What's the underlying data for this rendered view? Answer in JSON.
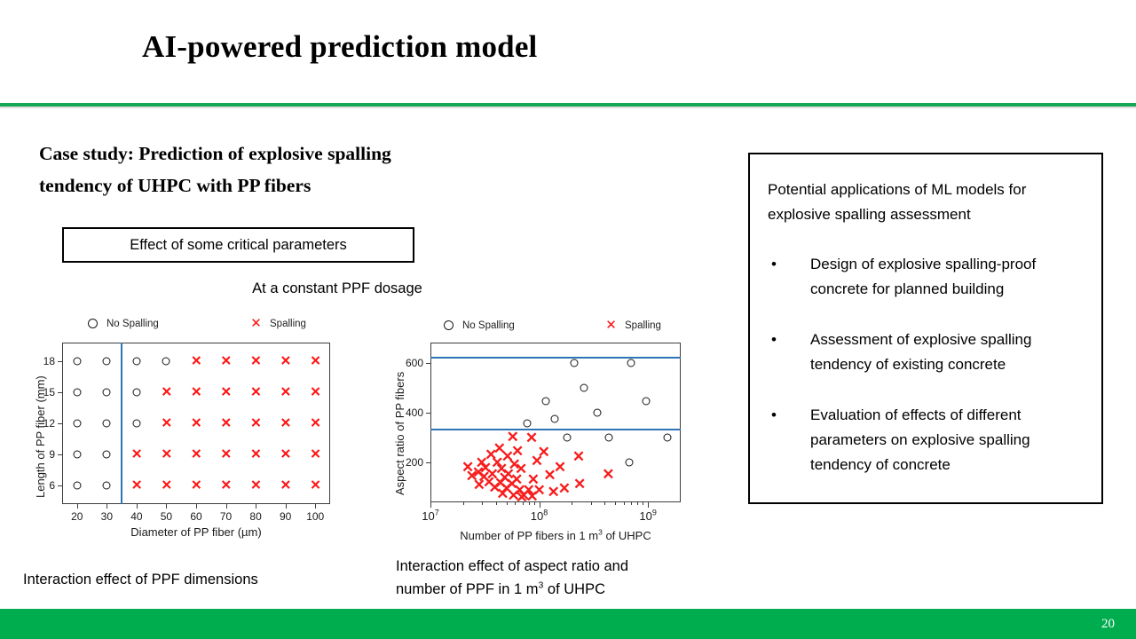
{
  "slide": {
    "title": "AI-powered prediction model",
    "page_number": "20",
    "accent_green": "#00ad4e",
    "rule_green": "#14a856"
  },
  "left": {
    "case_study_line1": "Case study: Prediction of explosive spalling",
    "case_study_line2": "tendency of UHPC with PP fibers",
    "param_box_label": "Effect of some critical parameters",
    "dosage_label": "At a constant PPF dosage",
    "caption_left": "Interaction effect of PPF dimensions",
    "caption_right_line1": "Interaction effect of aspect ratio and",
    "caption_right_line2_a": "number of PPF in 1 m",
    "caption_right_line2_sup": "3",
    "caption_right_line2_b": " of UHPC"
  },
  "applications": {
    "intro": "Potential applications of ML models for explosive spalling assessment",
    "bullet_char": "•",
    "items": [
      " Design of explosive spalling-proof concrete for planned building",
      "Assessment of explosive spalling tendency of existing concrete",
      "Evaluation of effects of different parameters on explosive spalling tendency of concrete"
    ]
  },
  "chart_data": [
    {
      "id": "ppf-dimensions",
      "type": "scatter",
      "title": "Interaction effect of PPF dimensions",
      "xlabel": "Diameter of PP fiber (µm)",
      "ylabel": "Length of PP fiber (mm)",
      "xticks": [
        20,
        30,
        40,
        50,
        60,
        70,
        80,
        90,
        100
      ],
      "yticks": [
        6,
        9,
        12,
        15,
        18
      ],
      "xlim": [
        15,
        105
      ],
      "ylim": [
        4.2,
        19.8
      ],
      "grid": false,
      "legend": [
        {
          "label": "No Spalling",
          "marker": "circle",
          "color": "#161616"
        },
        {
          "label": "Spalling",
          "marker": "cross",
          "color": "#ff1212"
        }
      ],
      "legend_position": "above-plot",
      "threshold_line": {
        "orientation": "vertical",
        "x": 35,
        "color": "#2f74b5"
      },
      "series": [
        {
          "name": "No Spalling",
          "marker": "circle",
          "points": [
            [
              20,
              18
            ],
            [
              30,
              18
            ],
            [
              40,
              18
            ],
            [
              50,
              18
            ],
            [
              20,
              15
            ],
            [
              30,
              15
            ],
            [
              40,
              15
            ],
            [
              20,
              12
            ],
            [
              30,
              12
            ],
            [
              40,
              12
            ],
            [
              20,
              9
            ],
            [
              30,
              9
            ],
            [
              20,
              6
            ],
            [
              30,
              6
            ]
          ]
        },
        {
          "name": "Spalling",
          "marker": "cross",
          "points": [
            [
              60,
              18
            ],
            [
              70,
              18
            ],
            [
              80,
              18
            ],
            [
              90,
              18
            ],
            [
              100,
              18
            ],
            [
              50,
              15
            ],
            [
              60,
              15
            ],
            [
              70,
              15
            ],
            [
              80,
              15
            ],
            [
              90,
              15
            ],
            [
              100,
              15
            ],
            [
              50,
              12
            ],
            [
              60,
              12
            ],
            [
              70,
              12
            ],
            [
              80,
              12
            ],
            [
              90,
              12
            ],
            [
              100,
              12
            ],
            [
              40,
              9
            ],
            [
              50,
              9
            ],
            [
              60,
              9
            ],
            [
              70,
              9
            ],
            [
              80,
              9
            ],
            [
              90,
              9
            ],
            [
              100,
              9
            ],
            [
              40,
              6
            ],
            [
              50,
              6
            ],
            [
              60,
              6
            ],
            [
              70,
              6
            ],
            [
              80,
              6
            ],
            [
              90,
              6
            ],
            [
              100,
              6
            ]
          ]
        }
      ]
    },
    {
      "id": "aspect-ratio-vs-number",
      "type": "scatter",
      "title": "Interaction effect of aspect ratio and number of PPF in 1 m3 of UHPC",
      "xlabel": "Number of PP fibers in 1 m3 of UHPC",
      "ylabel": "Aspect ratio of PP fibers",
      "xscale": "log",
      "xticks": [
        "10^7",
        "10^8",
        "10^9"
      ],
      "yticks": [
        200,
        400,
        600
      ],
      "xlim": [
        10000000.0,
        2000000000.0
      ],
      "ylim": [
        40,
        680
      ],
      "grid": false,
      "legend": [
        {
          "label": "No Spalling",
          "marker": "circle",
          "color": "#161616"
        },
        {
          "label": "Spalling",
          "marker": "cross",
          "color": "#ff1212"
        }
      ],
      "legend_position": "above-plot",
      "threshold_lines": [
        {
          "orientation": "horizontal",
          "y": 620,
          "color": "#2f74b5"
        },
        {
          "orientation": "horizontal",
          "y": 333,
          "color": "#2f74b5"
        }
      ],
      "series": [
        {
          "name": "No Spalling",
          "marker": "circle",
          "points": [
            [
              210000000.0,
              600
            ],
            [
              700000000.0,
              600
            ],
            [
              260000000.0,
              500
            ],
            [
              115000000.0,
              447
            ],
            [
              960000000.0,
              447
            ],
            [
              340000000.0,
              400
            ],
            [
              140000000.0,
              375
            ],
            [
              78000000.0,
              358
            ],
            [
              180000000.0,
              300
            ],
            [
              440000000.0,
              300
            ],
            [
              1500000000.0,
              300
            ],
            [
              670000000.0,
              200
            ]
          ]
        },
        {
          "name": "Spalling",
          "marker": "cross",
          "points": [
            [
              57000000.0,
              298
            ],
            [
              85000000.0,
              296
            ],
            [
              43000000.0,
              255
            ],
            [
              63000000.0,
              243
            ],
            [
              110000000.0,
              238
            ],
            [
              36000000.0,
              228
            ],
            [
              51000000.0,
              222
            ],
            [
              95000000.0,
              205
            ],
            [
              29500000.0,
              198
            ],
            [
              41000000.0,
              196
            ],
            [
              59000000.0,
              190
            ],
            [
              230000000.0,
              220
            ],
            [
              22000000.0,
              178
            ],
            [
              32000000.0,
              176
            ],
            [
              45000000.0,
              172
            ],
            [
              68000000.0,
              170
            ],
            [
              155000000.0,
              177
            ],
            [
              27500000.0,
              158
            ],
            [
              37000000.0,
              152
            ],
            [
              52000000.0,
              150
            ],
            [
              125000000.0,
              148
            ],
            [
              430000000.0,
              150
            ],
            [
              24000000.0,
              143
            ],
            [
              31000000.0,
              138
            ],
            [
              48000000.0,
              135
            ],
            [
              62000000.0,
              130
            ],
            [
              88000000.0,
              128
            ],
            [
              34500000.0,
              118
            ],
            [
              44000000.0,
              113
            ],
            [
              56000000.0,
              110
            ],
            [
              28000000.0,
              108
            ],
            [
              235000000.0,
              112
            ],
            [
              39000000.0,
              96
            ],
            [
              50000000.0,
              92
            ],
            [
              66000000.0,
              88
            ],
            [
              80000000.0,
              86
            ],
            [
              100000000.0,
              85
            ],
            [
              170000000.0,
              95
            ],
            [
              46000000.0,
              72
            ],
            [
              58000000.0,
              66
            ],
            [
              72000000.0,
              64
            ],
            [
              69000000.0,
              58
            ],
            [
              86000000.0,
              62
            ],
            [
              135000000.0,
              78
            ]
          ]
        }
      ]
    }
  ]
}
